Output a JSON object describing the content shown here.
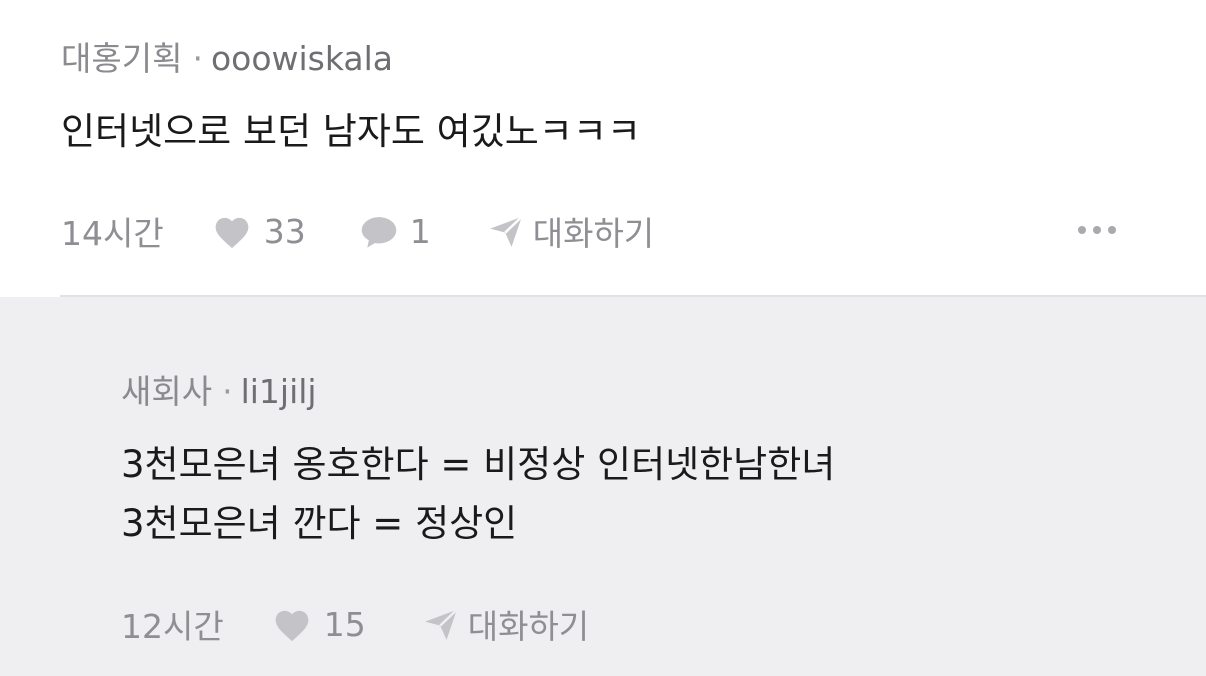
{
  "comment": {
    "author_group": "대홍기획",
    "separator": "·",
    "username": "ooowiskala",
    "text": "인터넷으로 보던 남자도 여깄노ㅋㅋㅋ",
    "time": "14시간",
    "likes": "33",
    "replies": "1",
    "conversation_label": "대화하기"
  },
  "reply": {
    "author_group": "새회사",
    "separator": "·",
    "username": "li1jilj",
    "lines": [
      "3천모은녀 옹호한다 = 비정상 인터넷한남한녀",
      "3천모은녀 깐다 = 정상인"
    ],
    "time": "12시간",
    "likes": "15",
    "conversation_label": "대화하기"
  },
  "colors": {
    "meta_text": "#8a8a8f",
    "icon": "#c4c4c8",
    "reply_background": "#efeff1"
  },
  "icons": [
    "heart-icon",
    "comment-bubble-icon",
    "send-icon",
    "more-options-icon"
  ]
}
